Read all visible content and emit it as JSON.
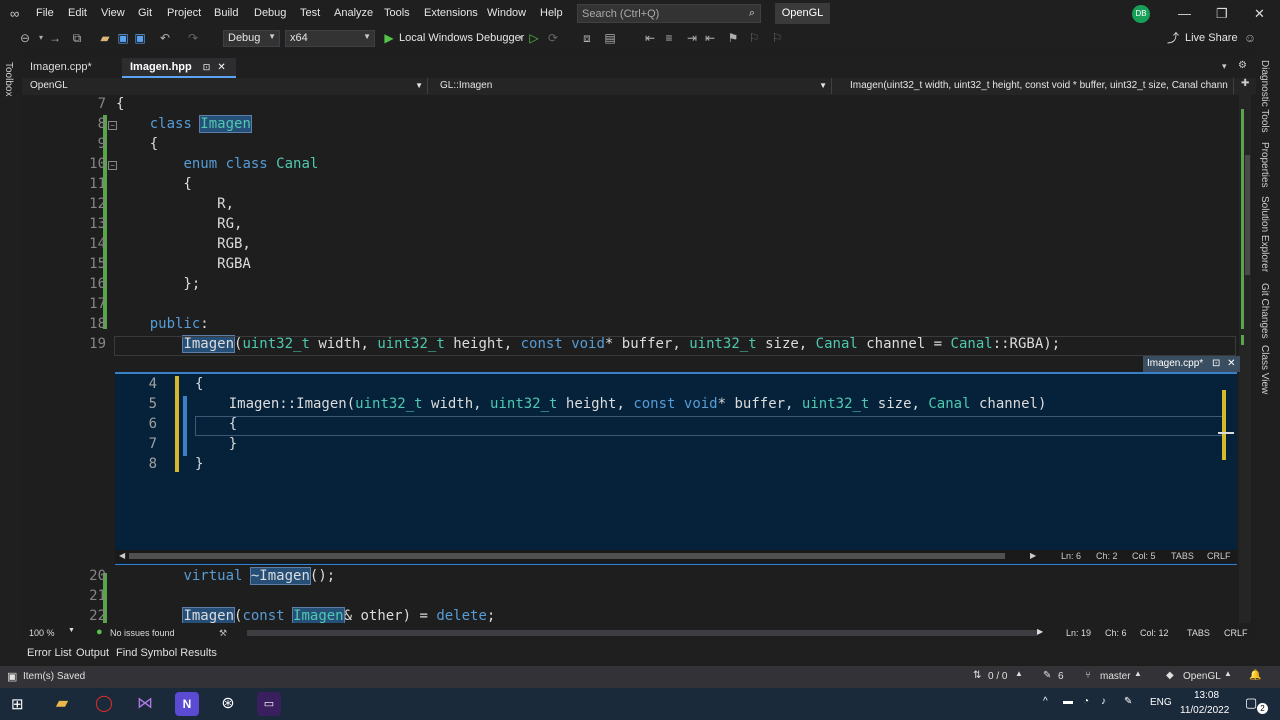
{
  "menu": {
    "items": [
      "File",
      "Edit",
      "View",
      "Git",
      "Project",
      "Build",
      "Debug",
      "Test",
      "Analyze",
      "Tools",
      "Extensions",
      "Window",
      "Help"
    ],
    "search_placeholder": "Search (Ctrl+Q)",
    "solution_name": "OpenGL",
    "avatar_initials": "DB"
  },
  "toolbar": {
    "config": "Debug",
    "platform": "x64",
    "run_label": "Local Windows Debugger",
    "live_share": "Live Share"
  },
  "left_strip": {
    "toolbox": "Toolbox"
  },
  "right_strip": [
    "Diagnostic Tools",
    "Properties",
    "Solution Explorer",
    "Git Changes",
    "Class View"
  ],
  "tabs": [
    {
      "label": "Imagen.cpp*"
    },
    {
      "label": "Imagen.hpp",
      "pin": "⊡",
      "close": "✕"
    }
  ],
  "navbar": {
    "project": "OpenGL",
    "scope": "GL::Imagen",
    "member": "Imagen(uint32_t width, uint32_t height, const void * buffer, uint32_t size, Canal chann"
  },
  "code_lines": [
    {
      "n": "7",
      "parts": [
        {
          "t": "{"
        }
      ]
    },
    {
      "n": "8",
      "parts": [
        {
          "t": "    "
        },
        {
          "t": "class ",
          "c": "kw"
        },
        {
          "t": "Imagen",
          "c": "ty hl"
        }
      ]
    },
    {
      "n": "9",
      "parts": [
        {
          "t": "    {"
        }
      ]
    },
    {
      "n": "10",
      "parts": [
        {
          "t": "        "
        },
        {
          "t": "enum class ",
          "c": "kw"
        },
        {
          "t": "Canal",
          "c": "ty"
        }
      ]
    },
    {
      "n": "11",
      "parts": [
        {
          "t": "        {"
        }
      ]
    },
    {
      "n": "12",
      "parts": [
        {
          "t": "            R,"
        }
      ]
    },
    {
      "n": "13",
      "parts": [
        {
          "t": "            RG,"
        }
      ]
    },
    {
      "n": "14",
      "parts": [
        {
          "t": "            RGB,"
        }
      ]
    },
    {
      "n": "15",
      "parts": [
        {
          "t": "            RGBA"
        }
      ]
    },
    {
      "n": "16",
      "parts": [
        {
          "t": "        };"
        }
      ]
    },
    {
      "n": "17",
      "parts": [
        {
          "t": ""
        }
      ]
    },
    {
      "n": "18",
      "parts": [
        {
          "t": "    "
        },
        {
          "t": "public",
          "c": "kw"
        },
        {
          "t": ":"
        }
      ]
    },
    {
      "n": "19",
      "parts": [
        {
          "t": "        "
        },
        {
          "t": "Imagen",
          "c": "hl"
        },
        {
          "t": "("
        },
        {
          "t": "uint32_t",
          "c": "ty"
        },
        {
          "t": " width, "
        },
        {
          "t": "uint32_t",
          "c": "ty"
        },
        {
          "t": " height, "
        },
        {
          "t": "const void",
          "c": "kw"
        },
        {
          "t": "* buffer, "
        },
        {
          "t": "uint32_t",
          "c": "ty"
        },
        {
          "t": " size, "
        },
        {
          "t": "Canal",
          "c": "ty"
        },
        {
          "t": " channel = "
        },
        {
          "t": "Canal",
          "c": "ty"
        },
        {
          "t": "::RGBA);"
        }
      ]
    }
  ],
  "code_lines_after": [
    {
      "n": "20",
      "parts": [
        {
          "t": "        "
        },
        {
          "t": "virtual ",
          "c": "kw"
        },
        {
          "t": "~Imagen",
          "c": "hl"
        },
        {
          "t": "();"
        }
      ]
    },
    {
      "n": "21",
      "parts": [
        {
          "t": ""
        }
      ]
    },
    {
      "n": "22",
      "parts": [
        {
          "t": "        "
        },
        {
          "t": "Imagen",
          "c": "hl"
        },
        {
          "t": "("
        },
        {
          "t": "const ",
          "c": "kw"
        },
        {
          "t": "Imagen",
          "c": "ty hl"
        },
        {
          "t": "& other) = "
        },
        {
          "t": "delete",
          "c": "kw"
        },
        {
          "t": ";"
        }
      ]
    }
  ],
  "peek": {
    "title": "Imagen.cpp*",
    "lines": [
      {
        "n": "4",
        "parts": [
          {
            "t": "{"
          }
        ]
      },
      {
        "n": "5",
        "parts": [
          {
            "t": "    Imagen::Imagen("
          },
          {
            "t": "uint32_t",
            "c": "ty"
          },
          {
            "t": " width, "
          },
          {
            "t": "uint32_t",
            "c": "ty"
          },
          {
            "t": " height, "
          },
          {
            "t": "const void",
            "c": "kw"
          },
          {
            "t": "* buffer, "
          },
          {
            "t": "uint32_t",
            "c": "ty"
          },
          {
            "t": " size, "
          },
          {
            "t": "Canal",
            "c": "ty"
          },
          {
            "t": " channel)"
          }
        ]
      },
      {
        "n": "6",
        "parts": [
          {
            "t": "    {"
          }
        ]
      },
      {
        "n": "7",
        "parts": [
          {
            "t": "    }"
          }
        ]
      },
      {
        "n": "8",
        "parts": [
          {
            "t": "}"
          }
        ]
      }
    ],
    "status": {
      "ln": "Ln: 6",
      "ch": "Ch: 2",
      "col": "Col: 5",
      "tabs": "TABS",
      "eol": "CRLF"
    }
  },
  "editor_status": {
    "zoom": "100 %",
    "issues": "No issues found",
    "ln": "Ln: 19",
    "ch": "Ch: 6",
    "col": "Col: 12",
    "tabs": "TABS",
    "eol": "CRLF"
  },
  "bottom_tabs": [
    "Error List",
    "Output",
    "Find Symbol Results"
  ],
  "statusbar": {
    "message": "Item(s) Saved",
    "updown": "0 / 0",
    "pending": "6",
    "branch": "master",
    "repo": "OpenGL"
  },
  "taskbar": {
    "lang": "ENG",
    "time": "13:08",
    "date": "11/02/2022",
    "notif_count": "2"
  },
  "colors": {
    "accent": "#5ba3f0",
    "peek_bg": "#05223a",
    "change_green": "#57a64a",
    "status_bar": "#333337"
  }
}
